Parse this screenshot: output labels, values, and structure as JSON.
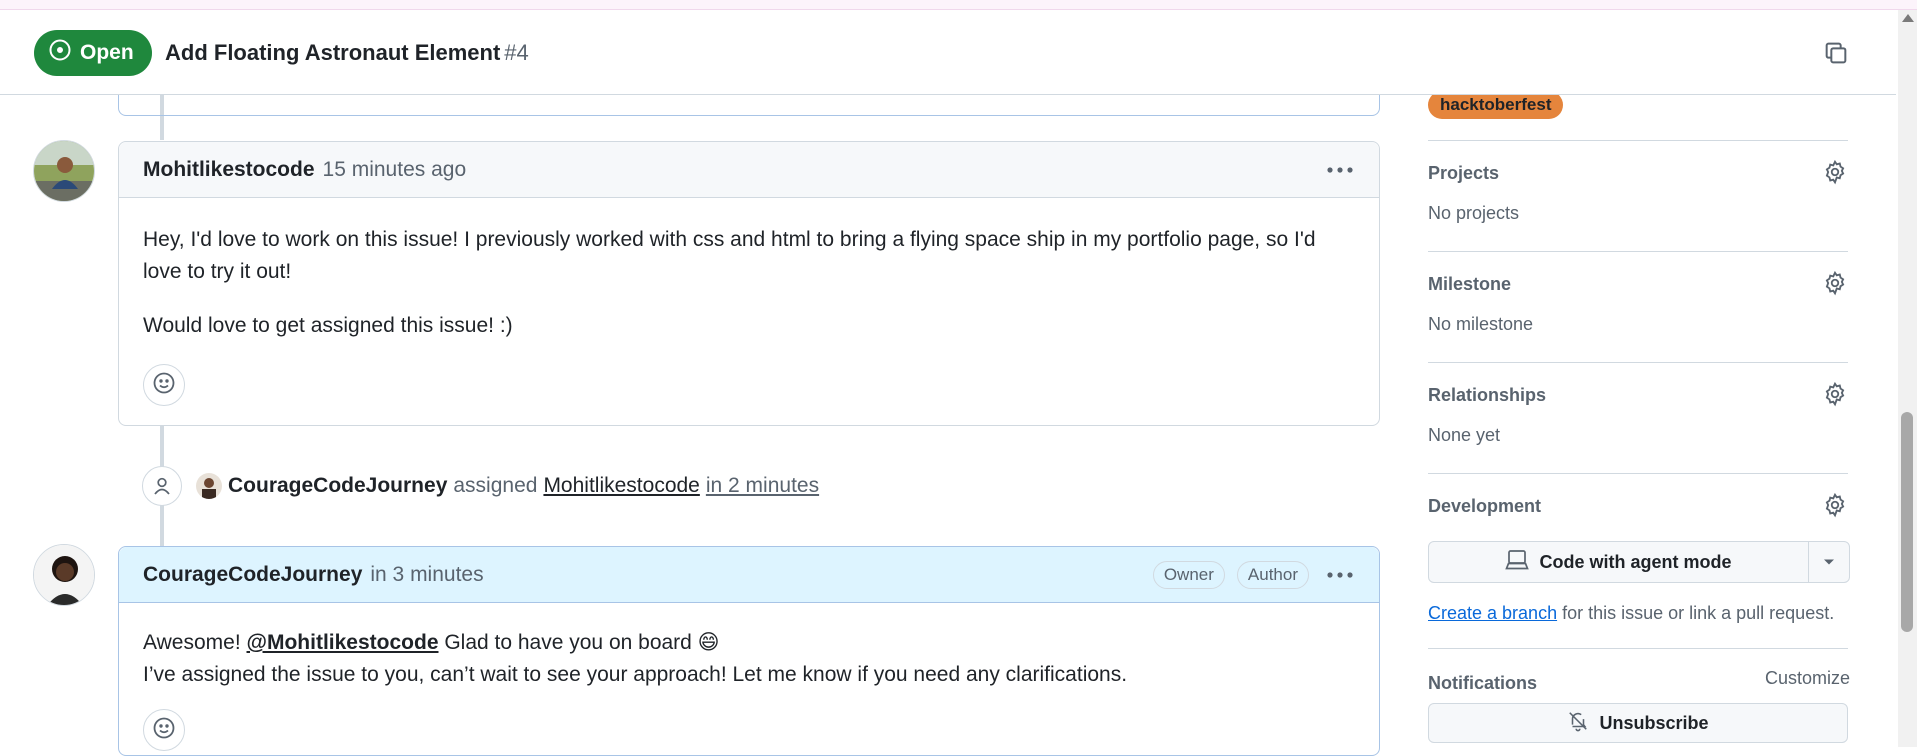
{
  "header": {
    "state": "Open",
    "title": "Add Floating Astronaut Element",
    "number": "#4"
  },
  "comments": [
    {
      "author": "Mohitlikestocode",
      "time": "15 minutes ago",
      "paragraphs": [
        "Hey, I'd love to work on this issue! I previously worked with css and html to bring a flying space ship in my portfolio page, so I'd love to try it out!",
        "Would love to get assigned this issue! :)"
      ]
    },
    {
      "author": "CourageCodeJourney",
      "time": "in 3 minutes",
      "badges": [
        "Owner",
        "Author"
      ],
      "line1_prefix": "Awesome! ",
      "mention": "@Mohitlikestocode",
      "line1_suffix": " Glad to have you on board 😄",
      "line2": "I’ve assigned the issue to you, can’t wait to see your approach! Let me know if you need any clarifications."
    }
  ],
  "event": {
    "actor": "CourageCodeJourney",
    "verb": "assigned",
    "target": "Mohitlikestocode",
    "time": "in 2 minutes"
  },
  "sidebar": {
    "label": "hacktoberfest",
    "projects": {
      "title": "Projects",
      "value": "No projects"
    },
    "milestone": {
      "title": "Milestone",
      "value": "No milestone"
    },
    "relationships": {
      "title": "Relationships",
      "value": "None yet"
    },
    "development": {
      "title": "Development",
      "button": "Code with agent mode",
      "link": "Create a branch",
      "hint_suffix": " for this issue or link a pull request."
    },
    "notifications": {
      "title": "Notifications",
      "customize": "Customize",
      "button": "Unsubscribe"
    }
  },
  "colors": {
    "open_green": "#1f883d",
    "owner_header_bg": "#ddf4ff",
    "label_orange": "#e5853c",
    "link_blue": "#0969da"
  }
}
